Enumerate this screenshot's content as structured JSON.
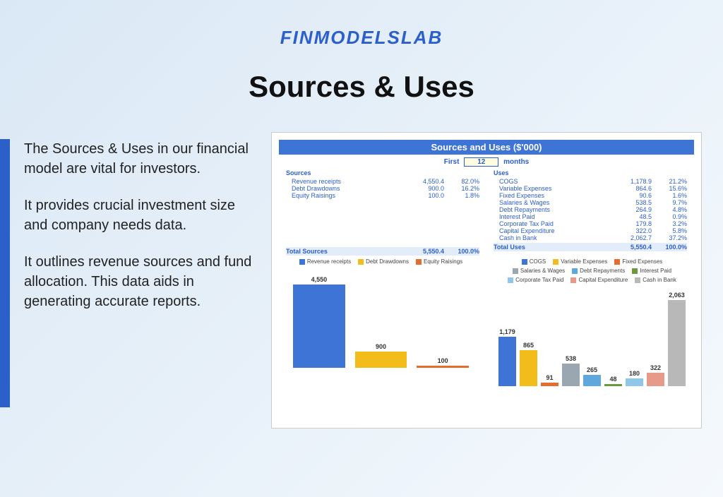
{
  "brand": "FINMODELSLAB",
  "title": "Sources & Uses",
  "paragraphs": [
    "The Sources & Uses in our financial model are vital for investors.",
    "It provides crucial investment size and company needs data.",
    "It outlines revenue sources and fund allocation. This data aids in generating accurate reports."
  ],
  "chart_header": "Sources and Uses ($'000)",
  "period": {
    "prefix": "First",
    "value": "12",
    "suffix": "months"
  },
  "sources_head": "Sources",
  "uses_head": "Uses",
  "total_sources_label": "Total Sources",
  "total_uses_label": "Total Uses",
  "sources": [
    {
      "label": "Revenue receipts",
      "value": "4,550.4",
      "pct": "82.0%"
    },
    {
      "label": "Debt Drawdowns",
      "value": "900.0",
      "pct": "16.2%"
    },
    {
      "label": "Equity Raisings",
      "value": "100.0",
      "pct": "1.8%"
    }
  ],
  "uses": [
    {
      "label": "COGS",
      "value": "1,178.9",
      "pct": "21.2%"
    },
    {
      "label": "Variable Expenses",
      "value": "864.6",
      "pct": "15.6%"
    },
    {
      "label": "Fixed Expenses",
      "value": "90.6",
      "pct": "1.6%"
    },
    {
      "label": "Salaries & Wages",
      "value": "538.5",
      "pct": "9.7%"
    },
    {
      "label": "Debt Repayments",
      "value": "264.9",
      "pct": "4.8%"
    },
    {
      "label": "Interest Paid",
      "value": "48.5",
      "pct": "0.9%"
    },
    {
      "label": "Corporate Tax Paid",
      "value": "179.8",
      "pct": "3.2%"
    },
    {
      "label": "Capital Expenditure",
      "value": "322.0",
      "pct": "5.8%"
    },
    {
      "label": "Cash in Bank",
      "value": "2,062.7",
      "pct": "37.2%"
    }
  ],
  "totals": {
    "sources_val": "5,550.4",
    "sources_pct": "100.0%",
    "uses_val": "5,550.4",
    "uses_pct": "100.0%"
  },
  "chart_data": [
    {
      "type": "bar",
      "title": "Sources",
      "categories": [
        "Revenue receipts",
        "Debt Drawdowns",
        "Equity Raisings"
      ],
      "values": [
        4550,
        900,
        100
      ],
      "labels": [
        "4,550",
        "900",
        "100"
      ],
      "colors": [
        "#3d74d6",
        "#f2bc1b",
        "#e66b2e"
      ],
      "ylim": [
        0,
        5000
      ]
    },
    {
      "type": "bar",
      "title": "Uses",
      "categories": [
        "COGS",
        "Variable Expenses",
        "Fixed Expenses",
        "Salaries & Wages",
        "Debt Repayments",
        "Interest Paid",
        "Corporate Tax Paid",
        "Capital Expenditure",
        "Cash in Bank"
      ],
      "values": [
        1179,
        865,
        91,
        538,
        265,
        48,
        180,
        322,
        2063
      ],
      "labels": [
        "1,179",
        "865",
        "91",
        "538",
        "265",
        "48",
        "180",
        "322",
        "2,063"
      ],
      "colors": [
        "#3d74d6",
        "#f2bc1b",
        "#e66b2e",
        "#9aa7b0",
        "#5fa8dd",
        "#6a9a3f",
        "#8fc7e8",
        "#e89a8a",
        "#b8b8b8"
      ],
      "ylim": [
        0,
        2200
      ]
    }
  ]
}
